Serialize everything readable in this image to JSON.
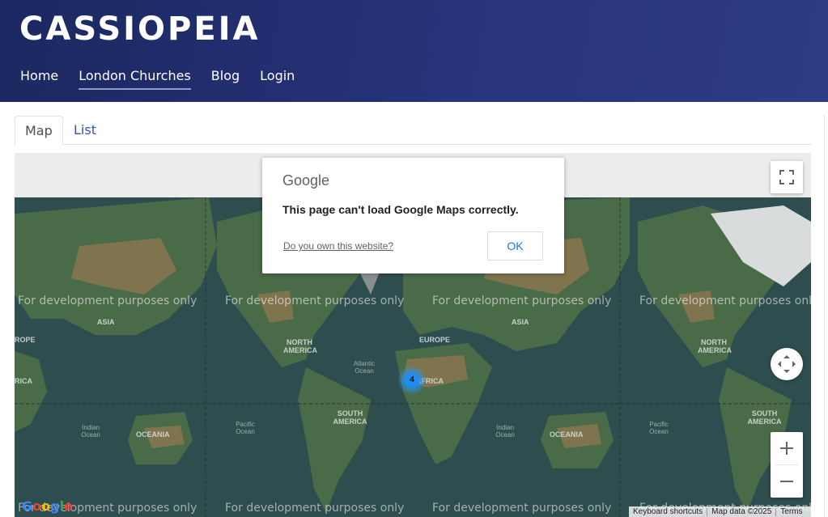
{
  "header": {
    "brand": "CASSIOPEIA",
    "nav": [
      "Home",
      "London Churches",
      "Blog",
      "Login"
    ],
    "active_nav": "London Churches"
  },
  "tabs": [
    "Map",
    "List"
  ],
  "active_tab": "Map",
  "map": {
    "watermark": "For development purposes only",
    "continents": [
      "ASIA",
      "NORTH AMERICA",
      "EUROPE",
      "AFRICA",
      "SOUTH AMERICA",
      "OCEANIA",
      "ASIA",
      "NORTH AMERICA",
      "SOUTH AMERICA",
      "OCEANIA",
      "ROPE",
      "RICA"
    ],
    "oceans": [
      "Atlantic Ocean",
      "Indian Ocean",
      "Pacific Ocean",
      "Indian Ocean",
      "Pacific Ocean"
    ],
    "cluster_count": "4",
    "dialog": {
      "logo": "Google",
      "message": "This page can't load Google Maps correctly.",
      "link": "Do you own this website?",
      "button": "OK"
    },
    "attribution": {
      "keyboard": "Keyboard shortcuts",
      "data": "Map data ©2025",
      "terms": "Terms"
    },
    "controls": [
      "fullscreen-icon",
      "camera-control-icon",
      "zoom-in-icon",
      "zoom-out-icon"
    ],
    "colors": {
      "ocean": "#2e4d4f",
      "cluster": "#1f8df0",
      "link": "#1a73e8"
    }
  }
}
